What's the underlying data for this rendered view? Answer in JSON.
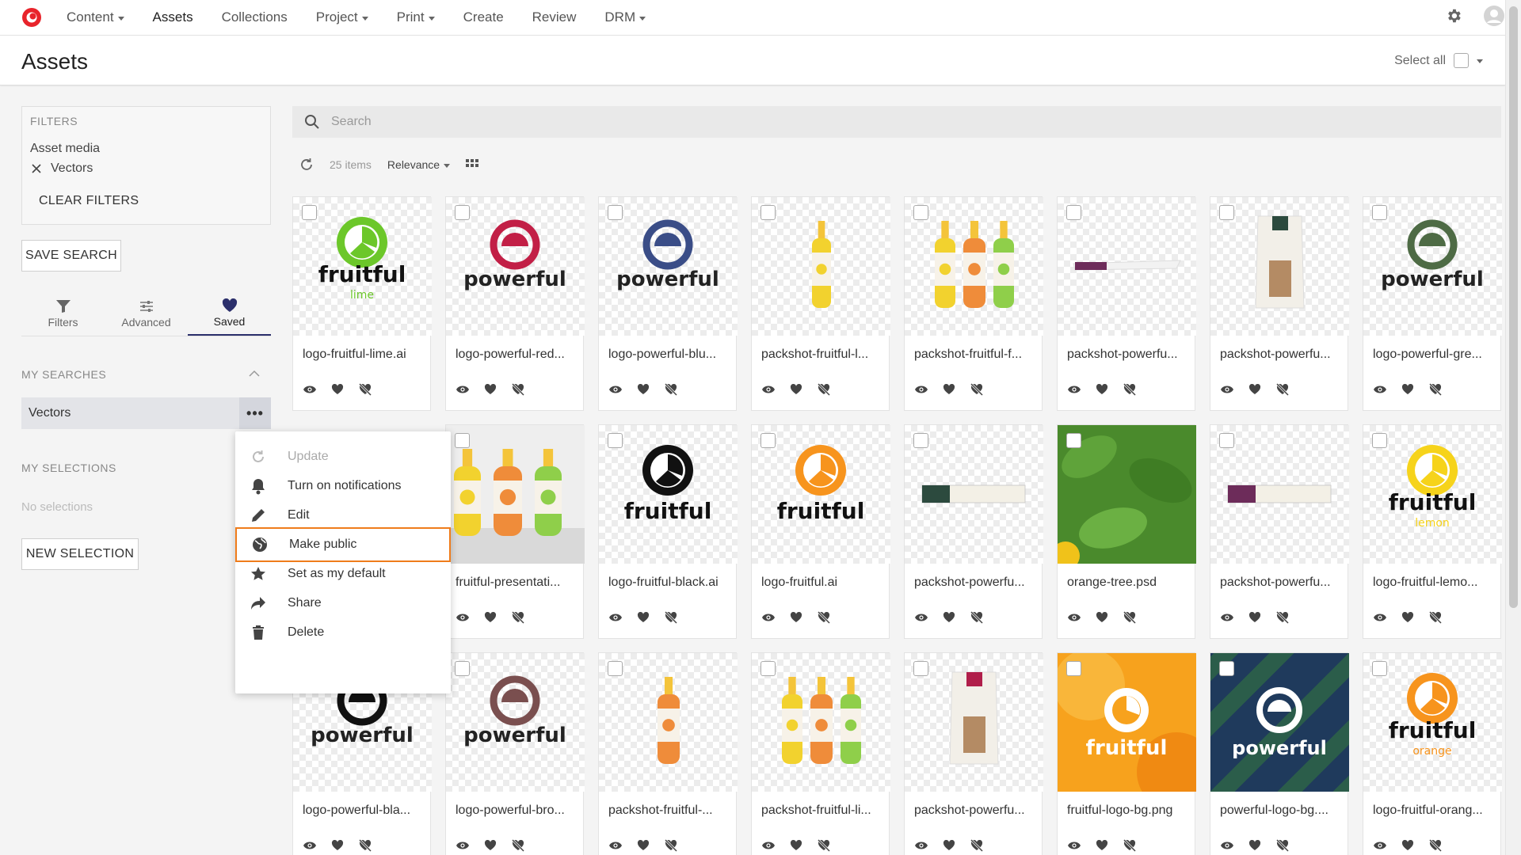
{
  "nav": {
    "items": [
      {
        "label": "Content",
        "dropdown": true
      },
      {
        "label": "Assets",
        "dropdown": false,
        "active": true
      },
      {
        "label": "Collections",
        "dropdown": false
      },
      {
        "label": "Project",
        "dropdown": true
      },
      {
        "label": "Print",
        "dropdown": true
      },
      {
        "label": "Create",
        "dropdown": false
      },
      {
        "label": "Review",
        "dropdown": false
      },
      {
        "label": "DRM",
        "dropdown": true
      }
    ],
    "icons": [
      "settings-icon",
      "user-avatar-icon"
    ]
  },
  "header": {
    "title": "Assets",
    "select_all": "Select all"
  },
  "filters": {
    "title": "FILTERS",
    "group": "Asset media",
    "chip": "Vectors",
    "clear": "CLEAR FILTERS"
  },
  "save_search": "SAVE SEARCH",
  "side_tabs": [
    {
      "label": "Filters",
      "icon": "funnel-icon"
    },
    {
      "label": "Advanced",
      "icon": "sliders-icon"
    },
    {
      "label": "Saved",
      "icon": "heart-icon",
      "active": true
    }
  ],
  "my_searches": {
    "title": "MY SEARCHES",
    "items": [
      "Vectors"
    ],
    "more": "•••"
  },
  "my_selections": {
    "title": "MY SELECTIONS",
    "empty": "No selections",
    "new": "NEW SELECTION"
  },
  "search": {
    "placeholder": "Search"
  },
  "toolbar": {
    "count": "25 items",
    "sort": "Relevance"
  },
  "context_menu": [
    {
      "label": "Update",
      "icon": "refresh-icon",
      "disabled": true
    },
    {
      "label": "Turn on notifications",
      "icon": "bell-icon"
    },
    {
      "label": "Edit",
      "icon": "pencil-icon"
    },
    {
      "label": "Make public",
      "icon": "globe-icon",
      "highlight": true
    },
    {
      "label": "Set as my default",
      "icon": "star-icon"
    },
    {
      "label": "Share",
      "icon": "share-icon"
    },
    {
      "label": "Delete",
      "icon": "trash-icon"
    }
  ],
  "colors": {
    "accent": "#2b2f6b",
    "highlight": "#ef7c1b",
    "brand_red": "#e8242b"
  },
  "assets": [
    {
      "name": "logo-fruitful-lime.ai",
      "thumb": "logo-fruitful-lime",
      "brand_word": "fruitful",
      "sub_word": "lime",
      "color": "#6cc72a"
    },
    {
      "name": "logo-powerful-red...",
      "thumb": "logo-powerful-red",
      "brand_word": "powerful",
      "color": "#c21f46"
    },
    {
      "name": "logo-powerful-blu...",
      "thumb": "logo-powerful-blue",
      "brand_word": "powerful",
      "color": "#3a4d87"
    },
    {
      "name": "packshot-fruitful-l...",
      "thumb": "bottle-lemon",
      "color": "#f2d22e"
    },
    {
      "name": "packshot-fruitful-f...",
      "thumb": "bottles-three",
      "color": "#ef8c3a"
    },
    {
      "name": "packshot-powerfu...",
      "thumb": "bar-purple",
      "color": "#6d2c5a"
    },
    {
      "name": "packshot-powerfu...",
      "thumb": "pouch-granola",
      "color": "#2c4a3e"
    },
    {
      "name": "logo-powerful-gre...",
      "thumb": "logo-powerful-green",
      "brand_word": "powerful",
      "color": "#4e6b45"
    },
    {
      "name": "",
      "thumb": "hidden",
      "color": "#ffffff"
    },
    {
      "name": "fruitful-presentati...",
      "thumb": "bottles-photo",
      "color": "#ef8c3a"
    },
    {
      "name": "logo-fruitful-black.ai",
      "thumb": "logo-fruitful-black",
      "brand_word": "fruitful",
      "color": "#111111"
    },
    {
      "name": "logo-fruitful.ai",
      "thumb": "logo-fruitful-orange",
      "brand_word": "fruitful",
      "color": "#f7941d"
    },
    {
      "name": "packshot-powerfu...",
      "thumb": "bar-green",
      "color": "#2c4a3e"
    },
    {
      "name": "orange-tree.psd",
      "thumb": "leaves-photo",
      "color": "#4a8a2c"
    },
    {
      "name": "packshot-powerfu...",
      "thumb": "bar-violet",
      "color": "#6d2c5a"
    },
    {
      "name": "logo-fruitful-lemo...",
      "thumb": "logo-fruitful-lemon",
      "brand_word": "fruitful",
      "sub_word": "lemon",
      "color": "#f6d31b"
    },
    {
      "name": "logo-powerful-bla...",
      "thumb": "logo-powerful-black",
      "brand_word": "powerful",
      "color": "#111111"
    },
    {
      "name": "logo-powerful-bro...",
      "thumb": "logo-powerful-brown",
      "brand_word": "powerful",
      "color": "#7a4f4f"
    },
    {
      "name": "packshot-fruitful-...",
      "thumb": "bottle-orange",
      "color": "#ef8c3a"
    },
    {
      "name": "packshot-fruitful-li...",
      "thumb": "bottles-three",
      "color": "#ef8c3a"
    },
    {
      "name": "packshot-powerfu...",
      "thumb": "pouch-red",
      "color": "#b01e4a"
    },
    {
      "name": "fruitful-logo-bg.png",
      "thumb": "logo-bg-orange",
      "brand_word": "fruitful",
      "color": "#f7a21d"
    },
    {
      "name": "powerful-logo-bg....",
      "thumb": "logo-bg-stripes",
      "brand_word": "powerful",
      "color": "#2b5d4a"
    },
    {
      "name": "logo-fruitful-orang...",
      "thumb": "logo-fruitful-orange-sub",
      "brand_word": "fruitful",
      "sub_word": "orange",
      "color": "#f7941d"
    }
  ]
}
